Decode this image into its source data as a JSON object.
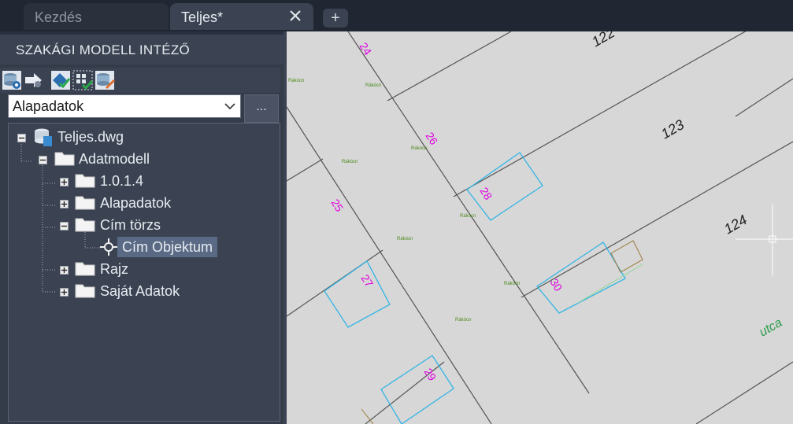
{
  "tabs": [
    {
      "label": "Kezdés"
    },
    {
      "label": "Teljes*"
    }
  ],
  "panel": {
    "title": "SZAKÁGI MODELL INTÉZŐ",
    "combo_value": "Alapadatok",
    "more_label": "...",
    "tree": [
      {
        "label": "Teljes.dwg"
      },
      {
        "label": "Adatmodell"
      },
      {
        "label": "1.0.1.4"
      },
      {
        "label": "Alapadatok"
      },
      {
        "label": "Cím törzs"
      },
      {
        "label": "Cím Objektum"
      },
      {
        "label": "Rajz"
      },
      {
        "label": "Saját Adatok"
      }
    ]
  },
  "map": {
    "parcel_numbers": [
      "24",
      "26",
      "25",
      "28",
      "27",
      "30",
      "29"
    ],
    "lot_numbers": [
      "122",
      "123",
      "124"
    ],
    "street_label": "utca",
    "small_labels": [
      "Rákócn",
      "Rákócn",
      "Rákócn",
      "Rákócn",
      "Rákócn",
      "Rákócn",
      "Rákócn",
      "Rákócn"
    ],
    "colors": {
      "parcel_number": "#e000e0",
      "building_outline": "#33b5e5",
      "street": "#2e9a4c",
      "lines": "#555555"
    }
  }
}
